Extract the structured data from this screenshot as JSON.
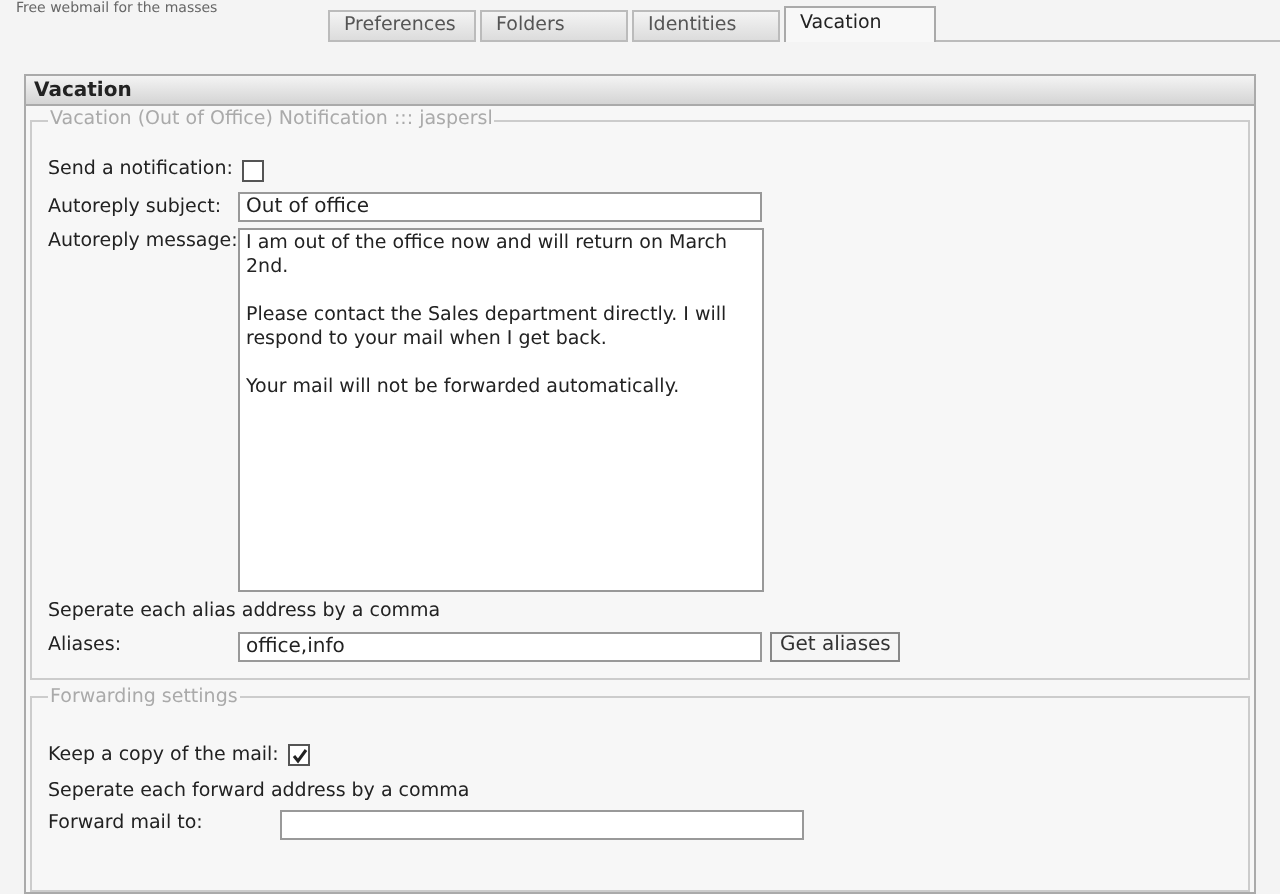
{
  "header": {
    "tagline": "Free webmail for the masses"
  },
  "tabs": [
    {
      "label": "Preferences",
      "selected": false
    },
    {
      "label": "Folders",
      "selected": false
    },
    {
      "label": "Identities",
      "selected": false
    },
    {
      "label": "Vacation",
      "selected": true
    }
  ],
  "panel": {
    "title": "Vacation"
  },
  "vacation": {
    "legend": "Vacation (Out of Office) Notification ::: jaspersl",
    "send_label": "Send a notification:",
    "send_checked": false,
    "subject_label": "Autoreply subject:",
    "subject_value": "Out of office",
    "message_label": "Autoreply message:",
    "message_value": "I am out of the office now and will return on March 2nd.\n\nPlease contact the Sales department directly. I will respond to your mail when I get back.\n\nYour mail will not be forwarded automatically.",
    "alias_hint": "Seperate each alias address by a comma",
    "aliases_label": "Aliases:",
    "aliases_value": "office,info",
    "get_aliases_button": "Get aliases"
  },
  "forwarding": {
    "legend": "Forwarding settings",
    "keep_label": "Keep a copy of the mail:",
    "keep_checked": true,
    "forward_hint": "Seperate each forward address by a comma",
    "forward_label": "Forward mail to:"
  }
}
